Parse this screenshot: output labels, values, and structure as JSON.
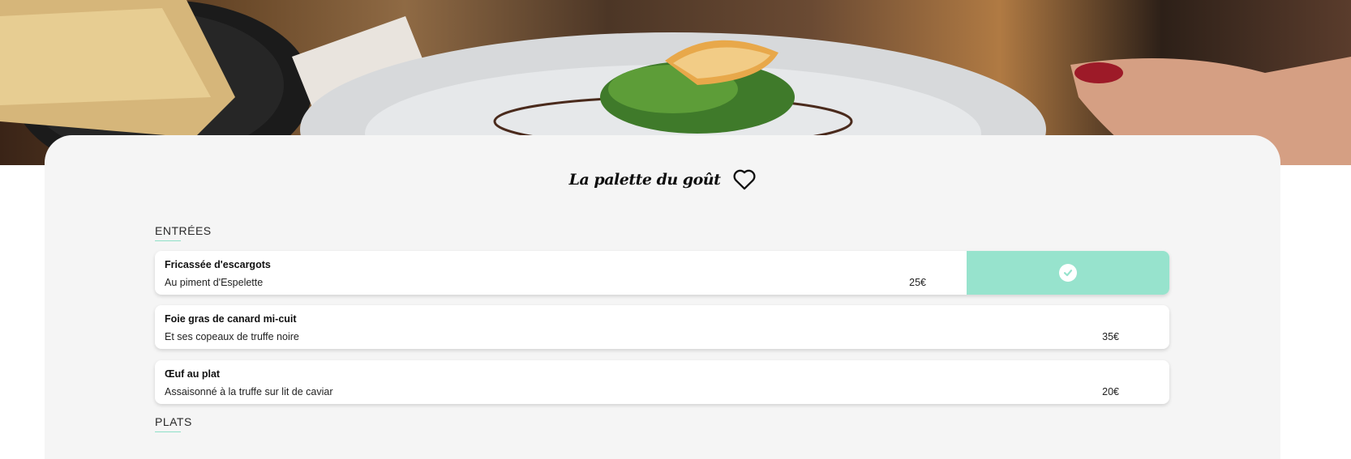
{
  "restaurant": {
    "title": "La palette du goût",
    "favorite_icon": "heart-outline-icon"
  },
  "sections": [
    {
      "title": "ENTRÉES",
      "dishes": [
        {
          "name": "Fricassée d'escargots",
          "description": "Au piment d'Espelette",
          "price": "25€",
          "selected": true
        },
        {
          "name": "Foie gras de canard mi-cuit",
          "description": "Et ses copeaux de truffe noire",
          "price": "35€",
          "selected": false
        },
        {
          "name": "Œuf au plat",
          "description": "Assaisonné à la truffe sur lit de caviar",
          "price": "20€",
          "selected": false
        }
      ]
    },
    {
      "title": "PLATS",
      "dishes": []
    }
  ],
  "colors": {
    "accent": "#97e3cd",
    "card_background": "#f5f5f5"
  },
  "icons": {
    "selected": "check-circle-icon"
  }
}
